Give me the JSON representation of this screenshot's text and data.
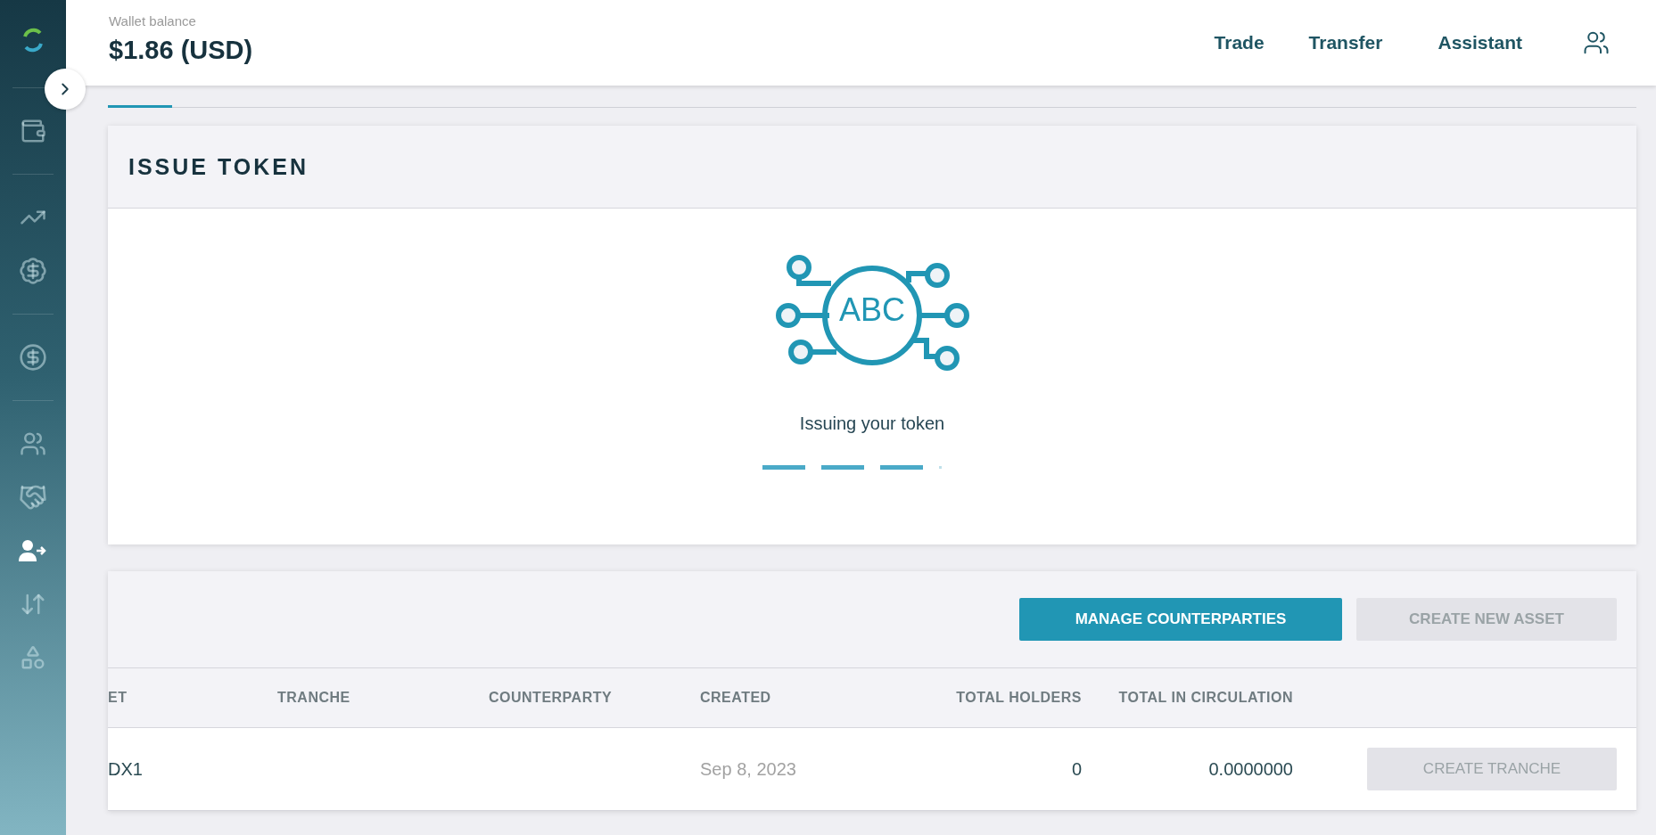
{
  "sidebar": {
    "groups": [
      [
        {
          "selected": false
        }
      ],
      [
        {
          "selected": false
        },
        {
          "selected": false
        }
      ],
      [
        {
          "selected": false
        }
      ],
      [
        {
          "selected": false
        },
        {
          "selected": false
        },
        {
          "selected": true
        },
        {
          "selected": false
        },
        {
          "selected": false
        }
      ]
    ]
  },
  "header": {
    "balance_label": "Wallet balance",
    "balance": "$1.86 (USD)",
    "nav": [
      "Trade",
      "Transfer",
      "Assistant"
    ]
  },
  "issue_card": {
    "title": "ISSUE TOKEN",
    "token_text": "ABC",
    "message": "Issuing your token"
  },
  "assets": {
    "buttons": [
      {
        "label": "MANAGE COUNTERPARTIES",
        "disabled": false
      },
      {
        "label": "CREATE NEW ASSET",
        "disabled": true
      }
    ],
    "columns": [
      "ET",
      "TRANCHE",
      "COUNTERPARTY",
      "CREATED",
      "TOTAL HOLDERS",
      "TOTAL IN CIRCULATION"
    ],
    "rows": [
      {
        "column_1": "DX1",
        "created": "Sep 8, 2023",
        "total_holders": "0",
        "total_in_circulation": "0.0000000",
        "action": {
          "label": "CREATE TRANCHE",
          "disabled": true
        }
      }
    ]
  }
}
